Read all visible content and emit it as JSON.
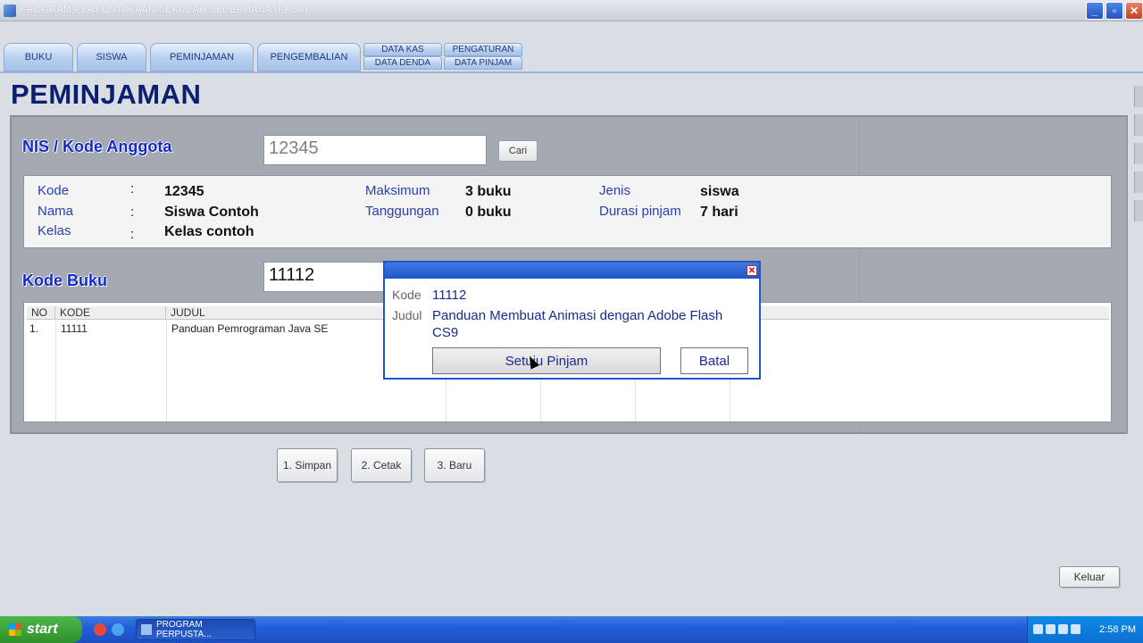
{
  "window": {
    "title": "PROGRAM PERPUSTAKAAN SEKOLAH SEDERHANA (PPSA)"
  },
  "tabs": {
    "buku": "BUKU",
    "siswa": "SISWA",
    "peminjaman": "PEMINJAMAN",
    "pengembalian": "PENGEMBALIAN",
    "data_kas": "DATA KAS",
    "data_denda": "DATA DENDA",
    "pengaturan": "PENGATURAN",
    "data_pinjam": "DATA PINJAM"
  },
  "page": {
    "title": "PEMINJAMAN"
  },
  "member": {
    "label": "NIS / Kode Anggota",
    "input_value": "12345",
    "search_button": "Cari"
  },
  "info": {
    "kode_label": "Kode",
    "kode_value": "12345",
    "nama_label": "Nama",
    "nama_value": "Siswa Contoh",
    "kelas_label": "Kelas",
    "kelas_value": "Kelas contoh",
    "colon": ":",
    "maksimum_label": "Maksimum",
    "maksimum_value": "3 buku",
    "tanggungan_label": "Tanggungan",
    "tanggungan_value": "0 buku",
    "jenis_label": "Jenis",
    "jenis_value": "siswa",
    "durasi_label": "Durasi pinjam",
    "durasi_value": "7 hari"
  },
  "book": {
    "label": "Kode Buku",
    "input_value": "11112"
  },
  "table": {
    "headers": [
      "NO",
      "KODE",
      "JUDUL"
    ],
    "rows": [
      {
        "no": "1.",
        "kode": "11111",
        "judul": "Panduan Pemrograman Java SE"
      }
    ]
  },
  "actions": {
    "simpan": "1. Simpan",
    "cetak": "2. Cetak",
    "baru": "3. Baru",
    "keluar": "Keluar"
  },
  "dialog": {
    "kode_label": "Kode",
    "kode_value": "11112",
    "judul_label": "Judul",
    "judul_value": "Panduan Membuat Animasi dengan Adobe Flash CS9",
    "confirm_button": "Setuju Pinjam",
    "cancel_button": "Batal"
  },
  "taskbar": {
    "start_label": "start",
    "task_label": "PROGRAM PERPUSTA...",
    "clock": "2:58 PM"
  },
  "colors": {
    "accent": "#1529c8",
    "dialog_border": "#1f56c9",
    "panel": "#a4a9b2"
  }
}
